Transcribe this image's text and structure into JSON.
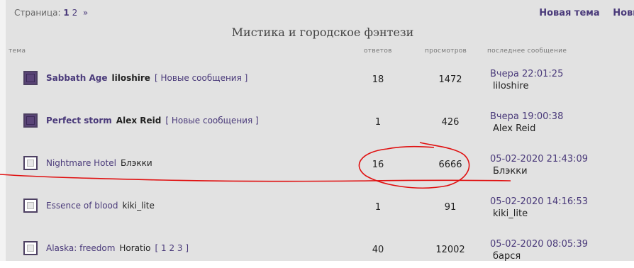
{
  "pager": {
    "label": "Страница:",
    "current": "1",
    "next_page": "2",
    "next_arrow": "»"
  },
  "actions": {
    "new_topic": "Новая тема",
    "new_poll": "Новы"
  },
  "forum_title": "Мистика и городское фэнтези",
  "columns": {
    "topic": "тема",
    "replies": "ответов",
    "views": "просмотров",
    "last": "последнее сообщение"
  },
  "rows": [
    {
      "title": "Sabbath Age",
      "author": "liloshire",
      "extra_open": "[",
      "extra_link": "Новые сообщения",
      "extra_close": "]",
      "replies": "18",
      "views": "1472",
      "last_time": "Вчера 22:01:25",
      "last_user": "liloshire",
      "unread": true
    },
    {
      "title": "Perfect storm",
      "author": "Alex Reid",
      "extra_open": "[",
      "extra_link": "Новые сообщения",
      "extra_close": "]",
      "replies": "1",
      "views": "426",
      "last_time": "Вчера 19:00:38",
      "last_user": "Alex Reid",
      "unread": true
    },
    {
      "title": "Nightmare Hotel",
      "author": "Блэкки",
      "replies": "16",
      "views": "6666",
      "last_time": "05-02-2020 21:43:09",
      "last_user": "Блэкки",
      "unread": false
    },
    {
      "title": "Essence of blood",
      "author": "kiki_lite",
      "replies": "1",
      "views": "91",
      "last_time": "05-02-2020 14:16:53",
      "last_user": "kiki_lite",
      "unread": false
    },
    {
      "title": "Alaska: freedom",
      "author": "Horatio",
      "extra_open": "[",
      "pages": [
        "1",
        "2",
        "3"
      ],
      "extra_close": "]",
      "replies": "40",
      "views": "12002",
      "last_time": "05-02-2020 08:05:39",
      "last_user": "барся",
      "unread": false
    }
  ],
  "colors": {
    "link": "#4a3a7a",
    "background": "#e2e2e2",
    "annotation": "#e01010"
  }
}
